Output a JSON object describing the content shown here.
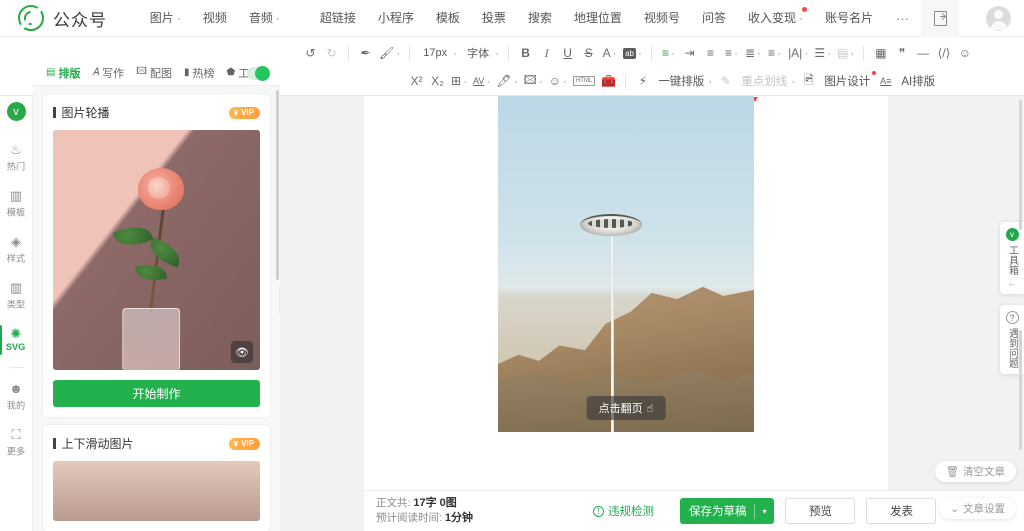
{
  "app": {
    "brand_name": "公众号",
    "logo_letter": ""
  },
  "topnav": {
    "group1": [
      {
        "label": "图片",
        "has_caret": true
      },
      {
        "label": "视频",
        "has_caret": false
      },
      {
        "label": "音频",
        "has_caret": true
      }
    ],
    "group2": [
      {
        "label": "超链接",
        "has_caret": false
      },
      {
        "label": "小程序",
        "has_caret": false
      },
      {
        "label": "模板",
        "has_caret": false
      },
      {
        "label": "投票",
        "has_caret": false
      },
      {
        "label": "搜索",
        "has_caret": false
      },
      {
        "label": "地理位置",
        "has_caret": false
      },
      {
        "label": "视频号",
        "has_caret": false
      },
      {
        "label": "问答",
        "has_caret": false
      },
      {
        "label": "收入变现",
        "has_caret": true,
        "badge": true
      },
      {
        "label": "账号名片",
        "has_caret": false
      }
    ],
    "more_label": "···",
    "exit_icon": "exit-icon",
    "avatar": "avatar"
  },
  "toolbar": {
    "row1": [
      {
        "name": "undo-button",
        "glyph": "↺"
      },
      {
        "name": "redo-button",
        "glyph": "↻",
        "dim": true
      },
      {
        "sep": true
      },
      {
        "name": "format-brush-button",
        "glyph": "✒"
      },
      {
        "name": "clear-format-button",
        "glyph": "⌫",
        "caret": true
      },
      {
        "sep": true
      },
      {
        "name": "font-size-select",
        "text": "17px",
        "caret": true
      },
      {
        "name": "font-family-select",
        "text": "字体",
        "caret": true
      },
      {
        "sep": true
      },
      {
        "name": "bold-button",
        "glyph": "B",
        "bold": true
      },
      {
        "name": "italic-button",
        "glyph": "I",
        "italic": true
      },
      {
        "name": "underline-button",
        "glyph": "U",
        "underline": true
      },
      {
        "name": "strikethrough-button",
        "glyph": "S",
        "strike": true
      },
      {
        "name": "font-color-button",
        "glyph": "A",
        "caret": true
      },
      {
        "name": "highlight-button",
        "glyph": "ab",
        "highlight": true,
        "caret": true
      },
      {
        "sep": true
      },
      {
        "name": "line-height-button",
        "glyph": "≡",
        "green": true,
        "caret": true
      },
      {
        "name": "indent-button",
        "glyph": "⇥"
      },
      {
        "name": "align-left-button",
        "glyph": "≡"
      },
      {
        "name": "align-center-button",
        "glyph": "≡",
        "caret": true
      },
      {
        "name": "align-justify-button",
        "glyph": "≡",
        "caret": true
      },
      {
        "name": "paragraph-spacing-button",
        "glyph": "≡",
        "caret": true
      },
      {
        "name": "letter-spacing-button",
        "glyph": "|A|",
        "caret": true
      },
      {
        "name": "list-button",
        "glyph": "☰",
        "caret": true
      },
      {
        "name": "background-button",
        "glyph": "▤",
        "dim": true,
        "caret": true
      },
      {
        "sep": true
      },
      {
        "name": "table-button",
        "glyph": "▦"
      },
      {
        "name": "quote-button",
        "glyph": "❞"
      },
      {
        "name": "divider-button",
        "glyph": "—"
      },
      {
        "name": "code-button",
        "glyph": "⟨/⟩"
      },
      {
        "name": "emoji-button",
        "glyph": "☺"
      }
    ],
    "row2": [
      {
        "name": "superscript-button",
        "glyph": "X²"
      },
      {
        "name": "subscript-button",
        "glyph": "X₂"
      },
      {
        "name": "text-frame-button",
        "glyph": "⊞",
        "caret": true
      },
      {
        "name": "kerning-button",
        "glyph": "AV",
        "caret": true
      },
      {
        "name": "highlighter-button",
        "glyph": "🖉",
        "caret": true
      },
      {
        "name": "image-button",
        "glyph": "🖼",
        "caret": true
      },
      {
        "name": "sticker-button",
        "glyph": "☺",
        "caret": true
      },
      {
        "name": "html-button",
        "glyph": "HTML"
      },
      {
        "name": "toolkit-button",
        "glyph": "🧰"
      },
      {
        "sep": true
      },
      {
        "name": "one-click-layout-button",
        "glyph": "⚡",
        "text": "一键排版",
        "caret": true
      },
      {
        "name": "key-underline-button",
        "glyph": "✎",
        "text": "重点划线",
        "dim": true,
        "caret": true
      },
      {
        "name": "image-design-button",
        "glyph": "🖼",
        "text": "图片设计",
        "badge": true
      },
      {
        "name": "ai-layout-button",
        "glyph": "A≡",
        "text": "AI排版"
      }
    ]
  },
  "rail": {
    "logo": "v",
    "items": [
      {
        "icon": "fire-icon",
        "glyph": "♨",
        "label": "热门",
        "active": false
      },
      {
        "icon": "template-icon",
        "glyph": "▣",
        "label": "模板",
        "active": false
      },
      {
        "icon": "style-icon",
        "glyph": "◈",
        "label": "样式",
        "active": false
      },
      {
        "icon": "type-icon",
        "glyph": "▥",
        "label": "类型",
        "active": false
      },
      {
        "icon": "svg-icon",
        "glyph": "✺",
        "label": "SVG",
        "active": true
      },
      {
        "divider": true
      },
      {
        "icon": "user-icon",
        "glyph": "☻",
        "label": "我的",
        "active": false
      },
      {
        "icon": "more-icon",
        "glyph": "⛶",
        "label": "更多",
        "active": false
      }
    ]
  },
  "panel": {
    "tabs": [
      {
        "icon": "layout-icon",
        "glyph": "▤",
        "label": "排版",
        "active": true
      },
      {
        "icon": "write-icon",
        "glyph": "AI",
        "label": "写作",
        "active": false
      },
      {
        "icon": "picture-icon",
        "glyph": "🖼",
        "label": "配图",
        "active": false
      },
      {
        "icon": "hotlist-icon",
        "glyph": "▮",
        "label": "热榜",
        "active": false
      },
      {
        "icon": "tools-icon",
        "glyph": "⬟",
        "label": "工具",
        "active": false
      }
    ],
    "toggle_on": true,
    "cards": [
      {
        "title": "图片轮播",
        "vip_label": "VIP",
        "preview_icon": "eye-icon",
        "action_label": "开始制作"
      },
      {
        "title": "上下滑动图片",
        "vip_label": "VIP"
      }
    ]
  },
  "editor": {
    "caption": "点击翻页",
    "caption_icon": "hand-pointer-icon"
  },
  "bottombar": {
    "stats_label_1": "正文共:",
    "stats_value_1": "17字 0图",
    "stats_label_2": "预计阅读时间:",
    "stats_value_2": "1分钟",
    "check_label": "违规检测",
    "save_label": "保存为草稿",
    "save_dropdown": "▾",
    "preview_label": "预览",
    "publish_label": "发表"
  },
  "floaters": {
    "toolbox_label": "工具箱",
    "toolbox_arrow": "←",
    "help_label": "遇到问题",
    "help_icon": "question-icon",
    "clear_label": "清空文章",
    "clear_icon": "trash-icon",
    "settings_label": "文章设置",
    "settings_icon": "chevron-down-icon"
  },
  "colors": {
    "brand_green": "#22a94e",
    "button_green": "#22b14c",
    "vip_orange": "#ff9d3c",
    "badge_red": "#f5483b"
  }
}
